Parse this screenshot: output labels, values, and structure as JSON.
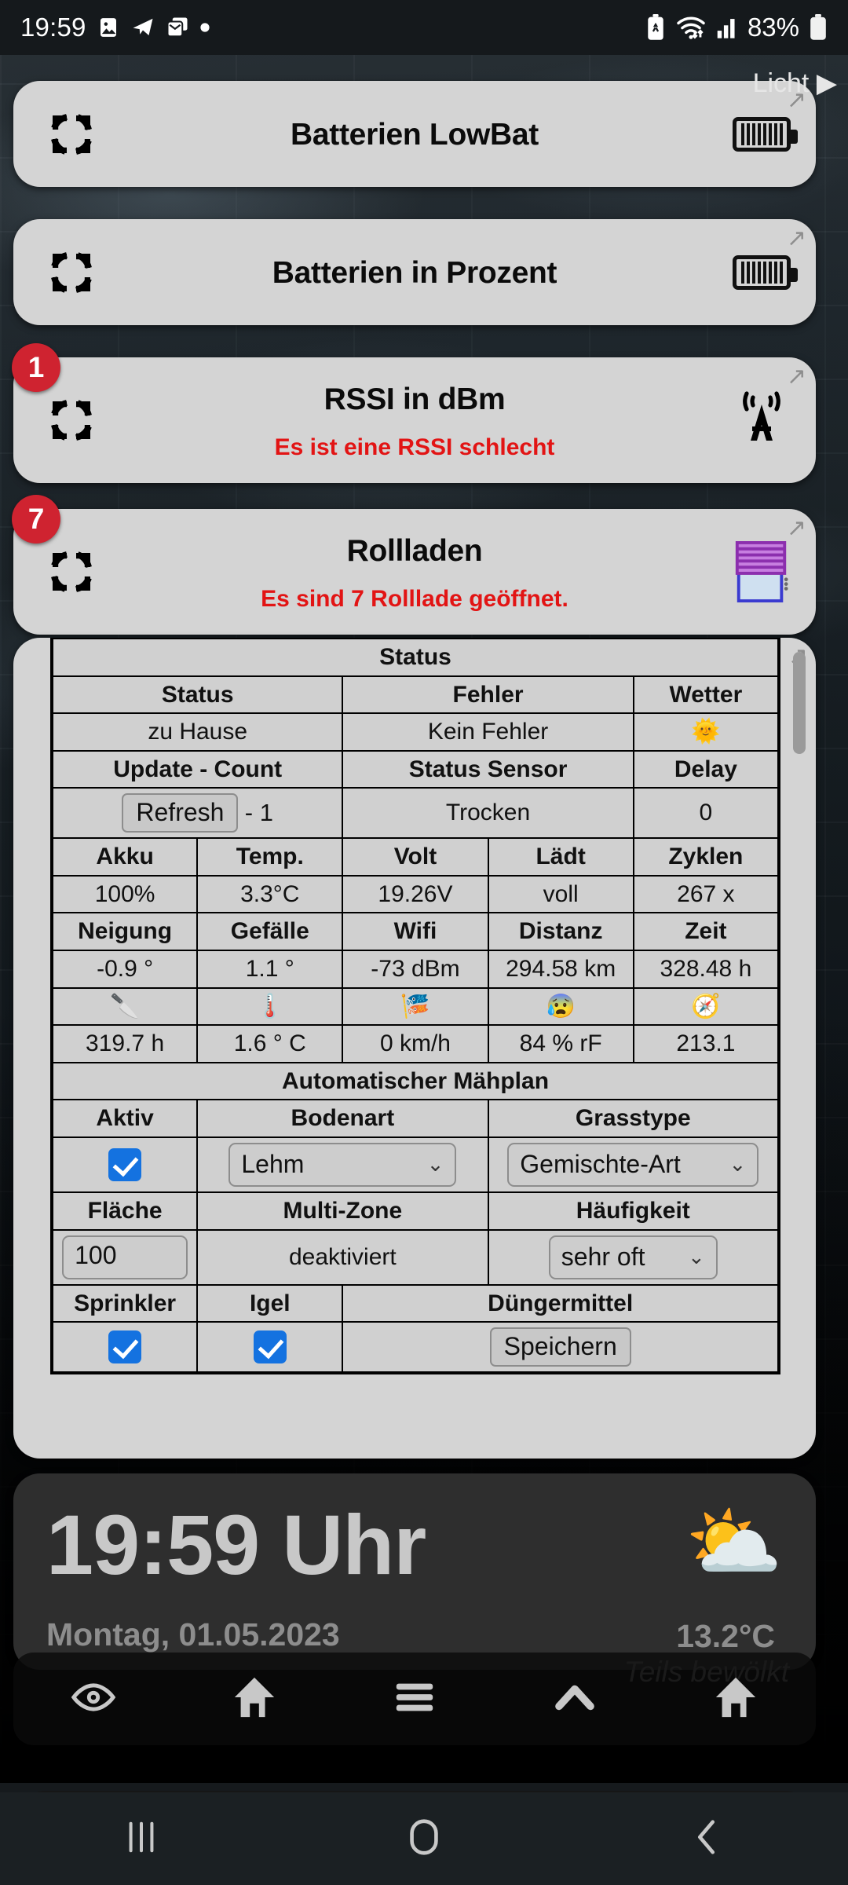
{
  "statusbar": {
    "time": "19:59",
    "battery_percent": "83%",
    "icons": [
      "gallery-icon",
      "telegram-icon",
      "mail-icon",
      "dot-icon",
      "battery-saver-icon",
      "wifi-icon",
      "signal-icon",
      "battery-icon"
    ]
  },
  "wallpaper_label": "Licht",
  "tiles": [
    {
      "title": "Batterien LowBat",
      "subtitle": "",
      "badge": "",
      "right_icon": "battery-icon",
      "left_icon": "refresh-icon",
      "arrow": "↗"
    },
    {
      "title": "Batterien in Prozent",
      "subtitle": "",
      "badge": "",
      "right_icon": "battery-icon",
      "left_icon": "refresh-icon",
      "arrow": "↗"
    },
    {
      "title": "RSSI in dBm",
      "subtitle": "Es ist eine RSSI schlecht",
      "badge": "1",
      "right_icon": "antenna-icon",
      "left_icon": "refresh-icon",
      "arrow": "↗"
    },
    {
      "title": "Rollladen",
      "subtitle": "Es sind 7 Rolllade geöffnet.",
      "badge": "7",
      "right_icon": "blinds-icon",
      "left_icon": "refresh-icon",
      "arrow": "↗"
    }
  ],
  "table": {
    "section_status": "Status",
    "section_mow": "Automatischer Mähplan",
    "row1_headers": [
      "Status",
      "Fehler",
      "Wetter"
    ],
    "row1_values": [
      "zu Hause",
      "Kein Fehler",
      "🌞"
    ],
    "row2_headers": [
      "Update - Count",
      "Status Sensor",
      "Delay"
    ],
    "refresh_button": "Refresh",
    "update_count": "- 1",
    "row2_values": [
      "Trocken",
      "0"
    ],
    "row3_headers": [
      "Akku",
      "Temp.",
      "Volt",
      "Lädt",
      "Zyklen"
    ],
    "row3_values": [
      "100%",
      "3.3°C",
      "19.26V",
      "voll",
      "267 x"
    ],
    "row4_headers": [
      "Neigung",
      "Gefälle",
      "Wifi",
      "Distanz",
      "Zeit"
    ],
    "row4_values": [
      "-0.9 °",
      "1.1 °",
      "-73 dBm",
      "294.58 km",
      "328.48 h"
    ],
    "row5_icons": [
      "🔪",
      "🌡️",
      "🎏",
      "😰",
      "🧭"
    ],
    "row5_values": [
      "319.7 h",
      "1.6 ° C",
      "0 km/h",
      "84 % rF",
      "213.1"
    ],
    "mow_headers_a": [
      "Aktiv",
      "Bodenart",
      "Grasstype"
    ],
    "mow_active_checked": true,
    "mow_bodenart": "Lehm",
    "mow_grasstype": "Gemischte-Art",
    "mow_headers_b": [
      "Fläche",
      "Multi-Zone",
      "Häufigkeit"
    ],
    "mow_flaeche": "100",
    "mow_multizone": "deaktiviert",
    "mow_haeufigkeit": "sehr oft",
    "mow_headers_c": [
      "Sprinkler",
      "Igel",
      "Düngermittel"
    ],
    "mow_sprinkler_checked": true,
    "mow_igel_checked": true,
    "mow_save_button": "Speichern",
    "arrow": "↗"
  },
  "clock_widget": {
    "time": "19:59 Uhr",
    "date": "Montag, 01.05.2023",
    "temperature": "13.2°C",
    "condition": "Teils bewölkt",
    "weather_icon": "⛅"
  },
  "dock": {
    "items": [
      "eye-icon",
      "home-icon",
      "menu-icon",
      "chevron-up-icon",
      "home-icon"
    ]
  },
  "navbar": {
    "items": [
      "recents-icon",
      "home-icon",
      "back-icon"
    ]
  },
  "colors": {
    "tile_bg": "#d4d4d4",
    "badge_red": "#cf2330",
    "alert_red": "#e21414",
    "section_blue": "#1616d8",
    "value_green": "#1a8a1a",
    "checkbox_blue": "#1472e0"
  }
}
